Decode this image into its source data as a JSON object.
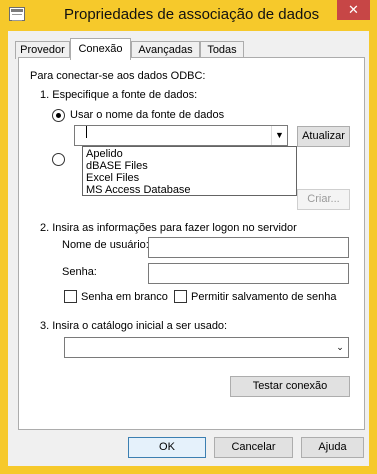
{
  "window": {
    "title": "Propriedades de associação de dados",
    "close_glyph": "✕"
  },
  "tabs": [
    {
      "label": "Provedor"
    },
    {
      "label": "Conexão"
    },
    {
      "label": "Avançadas"
    },
    {
      "label": "Todas"
    }
  ],
  "section_intro": "Para conectar-se aos dados ODBC:",
  "step1": {
    "label": "1. Especifique a fonte de dados:",
    "radio_dsn_label": "Usar o nome da fonte de dados",
    "dsn_value": "",
    "dropdown_options": [
      "Apelido",
      "dBASE Files",
      "Excel Files",
      "MS Access Database"
    ],
    "refresh_button": "Atualizar",
    "create_button": "Criar..."
  },
  "step2": {
    "label": "2. Insira as informações para fazer logon no servidor",
    "username_label": "Nome de usuário:",
    "username_value": "",
    "password_label": "Senha:",
    "password_value": "",
    "blank_password_label": "Senha em branco",
    "allow_save_label": "Permitir salvamento de senha"
  },
  "step3": {
    "label": "3. Insira o catálogo inicial a ser usado:",
    "catalog_value": ""
  },
  "test_button": "Testar conexão",
  "footer": {
    "ok": "OK",
    "cancel": "Cancelar",
    "help": "Ajuda"
  },
  "icons": {
    "dropdown_arrow": "▼",
    "combo_arrow": "⌄"
  }
}
